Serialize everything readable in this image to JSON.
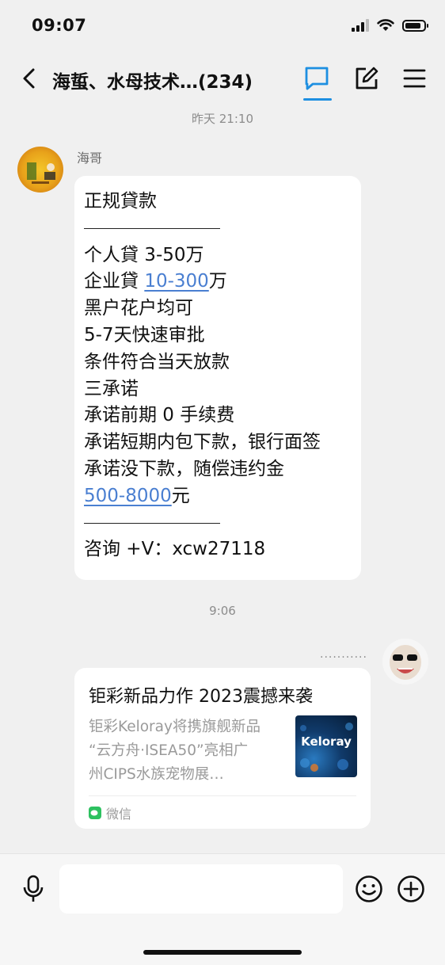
{
  "status_bar": {
    "time": "09:07",
    "battery_level": 0.85
  },
  "nav": {
    "title": "海蜇、水母技术…(234)"
  },
  "timestamps": [
    "昨天 21:10",
    "9:06"
  ],
  "message": {
    "sender": "海哥",
    "lines": {
      "l0": "正规貸款",
      "l1": "个人貸 3-50万",
      "l2_prefix": "企业貸 ",
      "l2_link": "10-300",
      "l2_suffix": "万",
      "l3": "黑户花户均可",
      "l4": "5-7天快速审批",
      "l5": "条件符合当天放款",
      "l6": "三承诺",
      "l7": "承诺前期 0 手续费",
      "l8": "承诺短期内包下款，银行面签",
      "l9": "承诺没下款，随偿违约金",
      "l10_link": "500-8000",
      "l10_suffix": "元",
      "l11": "咨询 +V：xcw27118"
    }
  },
  "outgoing": {
    "dots": "...........",
    "card": {
      "title": "钜彩新品力作 2023震撼来袭",
      "desc": [
        "钜彩Keloray将携旗舰新品",
        "“云方舟·ISEA50”亮相广",
        "州CIPS水族宠物展…"
      ],
      "thumb_label": "Keloray",
      "source": "微信"
    }
  },
  "input": {
    "value": "",
    "placeholder": ""
  },
  "colors": {
    "accent": "#1d8fe1",
    "link": "#4a7fd1",
    "wechat": "#2dc160"
  }
}
